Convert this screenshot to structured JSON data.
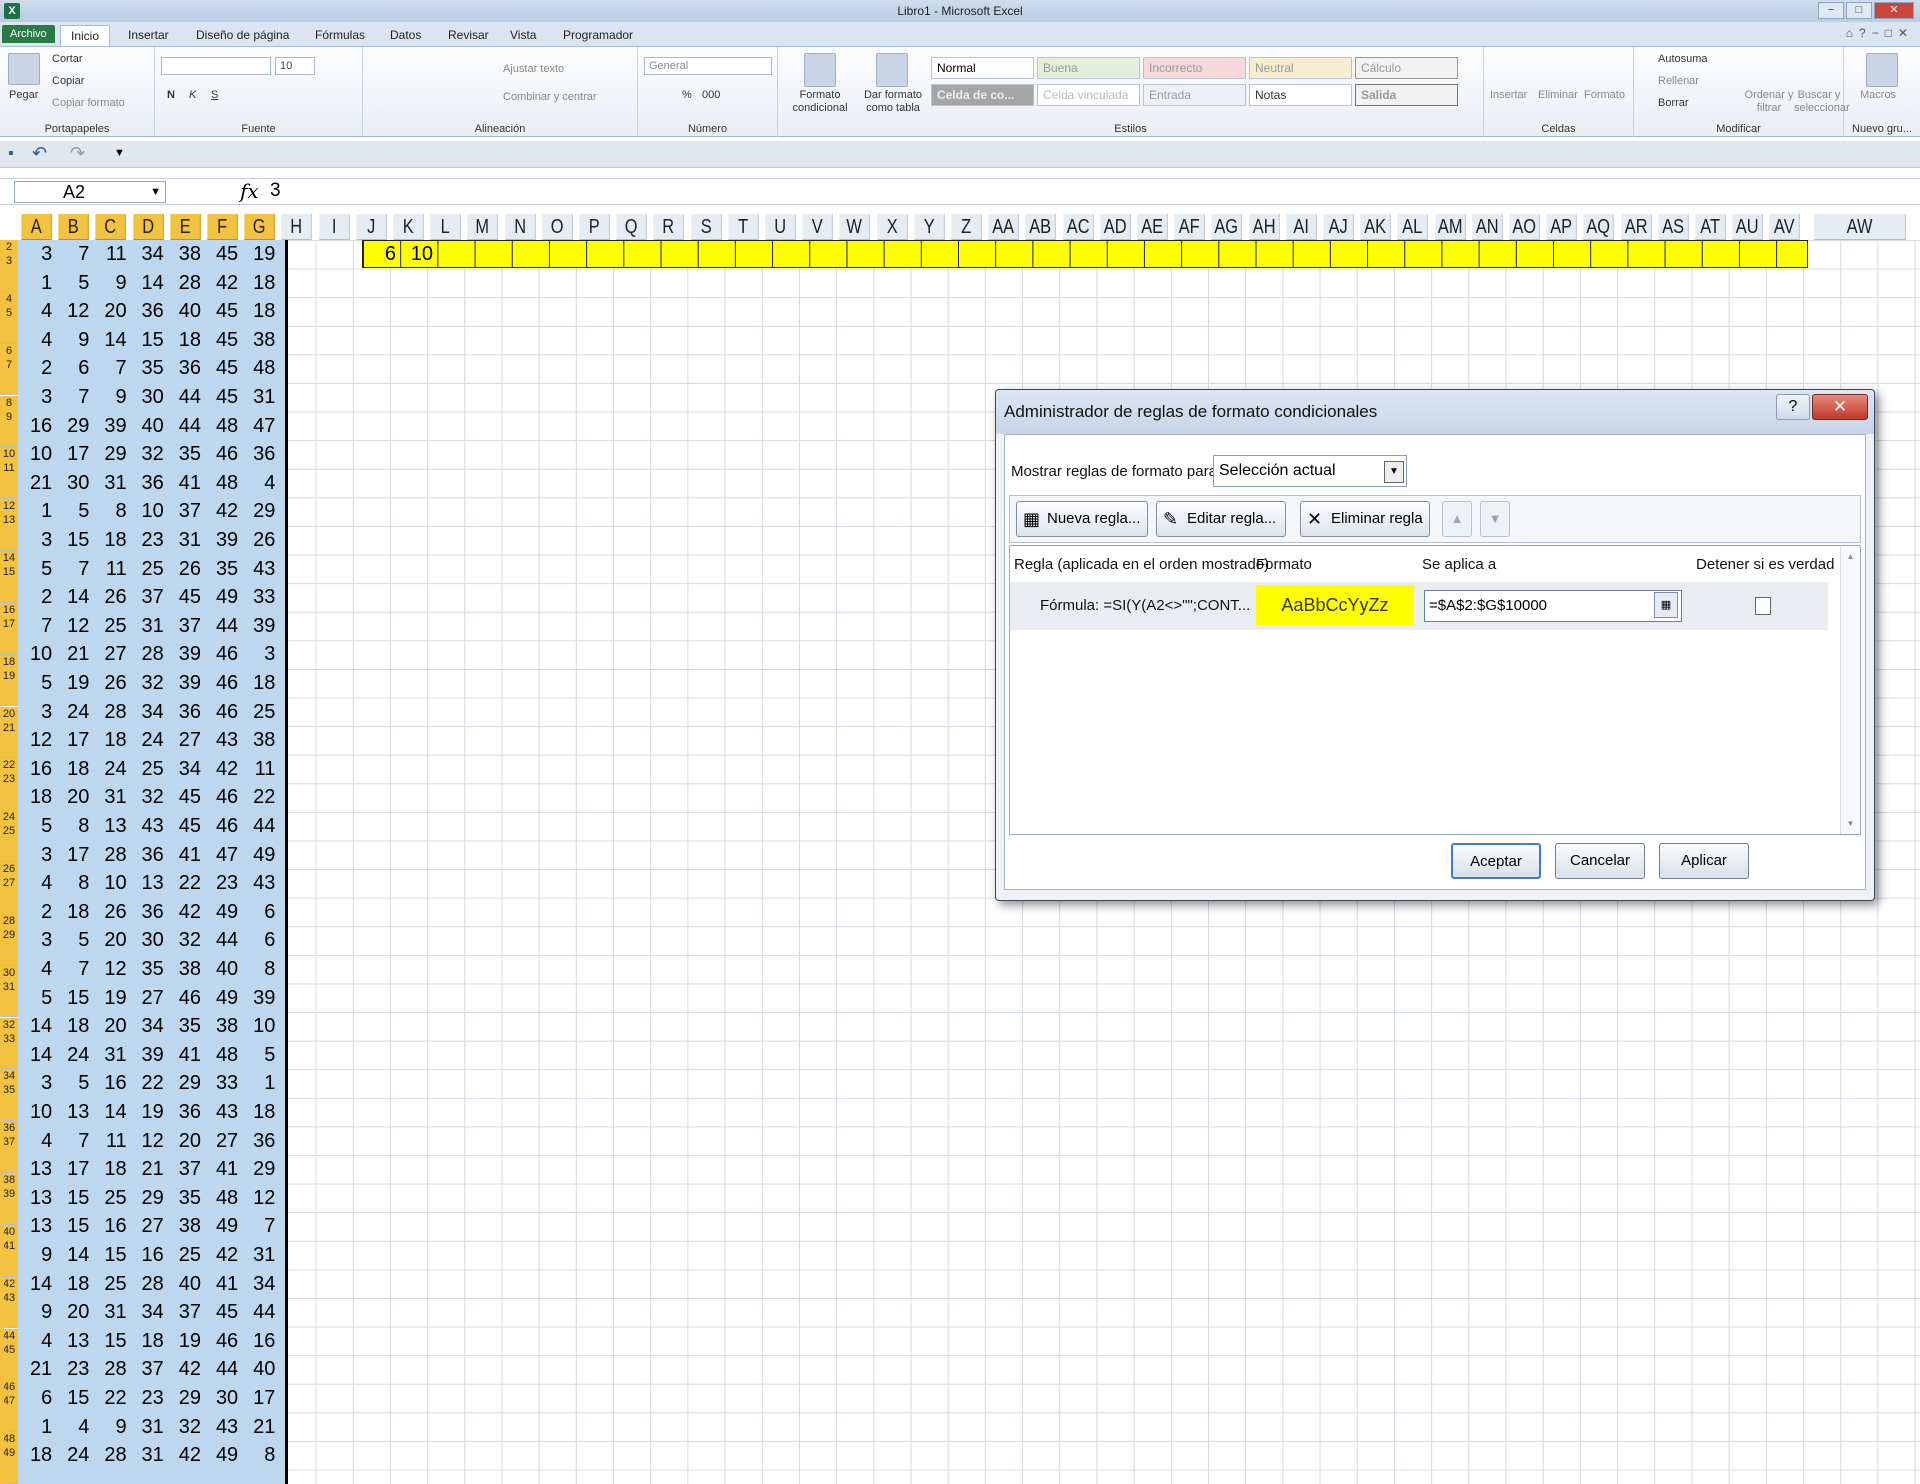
{
  "window": {
    "title": "Libro1  -  Microsoft Excel",
    "min": "−",
    "max": "□",
    "close": "✕"
  },
  "tabs": [
    "Archivo",
    "Inicio",
    "Insertar",
    "Diseño de página",
    "Fórmulas",
    "Datos",
    "Revisar",
    "Vista",
    "Programador"
  ],
  "ribbon": {
    "clipboard": {
      "label": "Portapapeles",
      "paste": "Pegar",
      "cut": "Cortar",
      "copy": "Copiar",
      "format_painter": "Copiar formato"
    },
    "font": {
      "label": "Fuente",
      "size": "10",
      "bold": "N",
      "italic": "K",
      "underline": "S"
    },
    "alignment": {
      "label": "Alineación",
      "wrap": "Ajustar texto",
      "merge": "Combinar y centrar"
    },
    "number": {
      "label": "Número",
      "format": "General",
      "percent": "%",
      "thousands": "000"
    },
    "styles": {
      "label": "Estilos",
      "cond_format": "Formato condicional",
      "table_format": "Dar formato como tabla",
      "cells": [
        "Normal",
        "Buena",
        "Incorrecto",
        "Neutral",
        "Cálculo",
        "Celda de co...",
        "Celda vinculada",
        "Entrada",
        "Notas",
        "Salida"
      ]
    },
    "cells": {
      "label": "Celdas",
      "insert": "Insertar",
      "delete": "Eliminar",
      "format": "Formato"
    },
    "editing": {
      "label": "Modificar",
      "autosum": "Autosuma",
      "fill": "Rellenar",
      "clear": "Borrar",
      "sort": "Ordenar y filtrar",
      "find": "Buscar y seleccionar"
    },
    "new_group": {
      "label": "Nuevo gru...",
      "macros": "Macros"
    }
  },
  "formula_bar": {
    "name_box": "A2",
    "fx": "fx",
    "value": "3"
  },
  "columns": [
    "A",
    "B",
    "C",
    "D",
    "E",
    "F",
    "G",
    "H",
    "I",
    "J",
    "K",
    "L",
    "M",
    "N",
    "O",
    "P",
    "Q",
    "R",
    "S",
    "T",
    "U",
    "V",
    "W",
    "X",
    "Y",
    "Z",
    "AA",
    "AB",
    "AC",
    "AD",
    "AE",
    "AF",
    "AG",
    "AH",
    "AI",
    "AJ",
    "AK",
    "AL",
    "AM",
    "AN",
    "AO",
    "AP",
    "AQ",
    "AR",
    "AS",
    "AT",
    "AU",
    "AV",
    "AW"
  ],
  "row_labels": [
    [
      "2",
      "3"
    ],
    [
      "4",
      "5"
    ],
    [
      "6",
      "7"
    ],
    [
      "8",
      "9"
    ],
    [
      "10",
      "11"
    ],
    [
      "12",
      "13"
    ],
    [
      "14",
      "15"
    ],
    [
      "16",
      "17"
    ],
    [
      "18",
      "19"
    ],
    [
      "20",
      "21"
    ],
    [
      "22",
      "23"
    ],
    [
      "24",
      "25"
    ],
    [
      "26",
      "27"
    ],
    [
      "28",
      "29"
    ],
    [
      "30",
      "31"
    ],
    [
      "32",
      "33"
    ],
    [
      "34",
      "35"
    ],
    [
      "36",
      "37"
    ],
    [
      "38",
      "39"
    ],
    [
      "40",
      "41"
    ],
    [
      "42",
      "43"
    ],
    [
      "44",
      "45"
    ],
    [
      "46",
      "47"
    ],
    [
      "48",
      "49"
    ]
  ],
  "rows": [
    [
      3,
      7,
      11,
      34,
      38,
      45,
      19
    ],
    [
      1,
      5,
      9,
      14,
      28,
      42,
      18
    ],
    [
      4,
      12,
      20,
      36,
      40,
      45,
      18
    ],
    [
      4,
      9,
      14,
      15,
      18,
      45,
      38
    ],
    [
      2,
      6,
      7,
      35,
      36,
      45,
      48
    ],
    [
      3,
      7,
      9,
      30,
      44,
      45,
      31
    ],
    [
      16,
      29,
      39,
      40,
      44,
      48,
      47
    ],
    [
      10,
      17,
      29,
      32,
      35,
      46,
      36
    ],
    [
      21,
      30,
      31,
      36,
      41,
      48,
      4
    ],
    [
      1,
      5,
      8,
      10,
      37,
      42,
      29
    ],
    [
      3,
      15,
      18,
      23,
      31,
      39,
      26
    ],
    [
      5,
      7,
      11,
      25,
      26,
      35,
      43
    ],
    [
      2,
      14,
      26,
      37,
      45,
      49,
      33
    ],
    [
      7,
      12,
      25,
      31,
      37,
      44,
      39
    ],
    [
      10,
      21,
      27,
      28,
      39,
      46,
      3
    ],
    [
      5,
      19,
      26,
      32,
      39,
      46,
      18
    ],
    [
      3,
      24,
      28,
      34,
      36,
      46,
      25
    ],
    [
      12,
      17,
      18,
      24,
      27,
      43,
      38
    ],
    [
      16,
      18,
      24,
      25,
      34,
      42,
      11
    ],
    [
      18,
      20,
      31,
      32,
      45,
      46,
      22
    ],
    [
      5,
      8,
      13,
      43,
      45,
      46,
      44
    ],
    [
      3,
      17,
      28,
      36,
      41,
      47,
      49
    ],
    [
      4,
      8,
      10,
      13,
      22,
      23,
      43
    ],
    [
      2,
      18,
      26,
      36,
      42,
      49,
      6
    ],
    [
      3,
      5,
      20,
      30,
      32,
      44,
      6
    ],
    [
      4,
      7,
      12,
      35,
      38,
      40,
      8
    ],
    [
      5,
      15,
      19,
      27,
      46,
      49,
      39
    ],
    [
      14,
      18,
      20,
      34,
      35,
      38,
      10
    ],
    [
      14,
      24,
      31,
      39,
      41,
      48,
      5
    ],
    [
      3,
      5,
      16,
      22,
      29,
      33,
      1
    ],
    [
      10,
      13,
      14,
      19,
      36,
      43,
      18
    ],
    [
      4,
      7,
      11,
      12,
      20,
      27,
      36
    ],
    [
      13,
      17,
      18,
      21,
      37,
      41,
      29
    ],
    [
      13,
      15,
      25,
      29,
      35,
      48,
      12
    ],
    [
      13,
      15,
      16,
      27,
      38,
      49,
      7
    ],
    [
      9,
      14,
      15,
      16,
      25,
      42,
      31
    ],
    [
      14,
      18,
      25,
      28,
      40,
      41,
      34
    ],
    [
      9,
      20,
      31,
      34,
      37,
      45,
      44
    ],
    [
      4,
      13,
      15,
      18,
      19,
      46,
      16
    ],
    [
      21,
      23,
      28,
      37,
      42,
      44,
      40
    ],
    [
      6,
      15,
      22,
      23,
      29,
      30,
      17
    ],
    [
      1,
      4,
      9,
      31,
      32,
      43,
      21
    ],
    [
      18,
      24,
      28,
      31,
      42,
      49,
      8
    ]
  ],
  "jk": [
    "6",
    "10"
  ],
  "dialog": {
    "title": "Administrador de reglas de formato condicionales",
    "help": "?",
    "close": "✕",
    "show_label": "Mostrar reglas de formato para:",
    "show_value": "Selección actual",
    "new_rule": "Nueva regla...",
    "edit_rule": "Editar regla...",
    "delete_rule": "Eliminar regla",
    "up": "▲",
    "down": "▼",
    "col_rule": "Regla (aplicada en el orden mostrado)",
    "col_format": "Formato",
    "col_applies": "Se aplica a",
    "col_stop": "Detener si es verdad",
    "rule": {
      "formula": "Fórmula: =SI(Y(A2<>\"\";CONT...",
      "preview": "AaBbCcYyZz",
      "applies_to": "=$A$2:$G$10000"
    },
    "ok": "Aceptar",
    "cancel": "Cancelar",
    "apply": "Aplicar"
  }
}
